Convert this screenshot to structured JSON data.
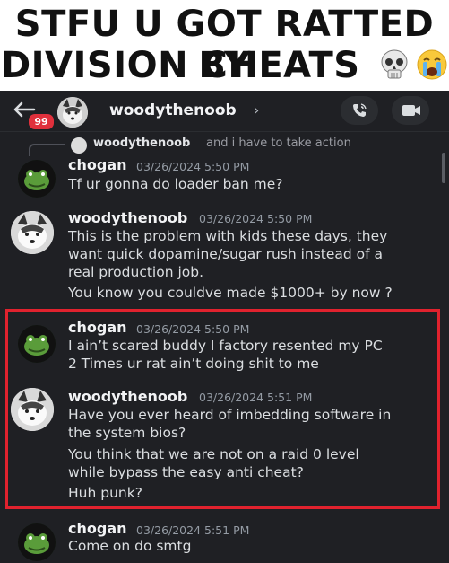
{
  "meme": {
    "line1": "STFU U GOT RATTED BY",
    "line2": "DIVISION CHEATS"
  },
  "header": {
    "badge_count": "99",
    "channel_name": "woodythenoob",
    "chevron": "›"
  },
  "reply": {
    "name": "woodythenoob",
    "text": "and i have to take action"
  },
  "messages": [
    {
      "author": "chogan",
      "timestamp": "03/26/2024 5:50 PM",
      "lines": [
        "Tf ur gonna do loader ban me?"
      ]
    },
    {
      "author": "woodythenoob",
      "timestamp": "03/26/2024 5:50 PM",
      "lines": [
        "This is the problem with kids these days, they",
        "want quick dopamine/sugar rush instead of a",
        "real production job.",
        "You know you couldve made $1000+ by now ?"
      ]
    },
    {
      "author": "chogan",
      "timestamp": "03/26/2024 5:50 PM",
      "lines": [
        "I ain’t scared buddy I factory resented my PC",
        "2 Times ur rat ain’t doing shit to me"
      ]
    },
    {
      "author": "woodythenoob",
      "timestamp": "03/26/2024 5:51 PM",
      "lines": [
        "Have you ever heard of imbedding software in",
        "the system bios?",
        "You think that we are not on a raid 0 level",
        "while bypass the easy anti cheat?",
        "Huh punk?"
      ]
    },
    {
      "author": "chogan",
      "timestamp": "03/26/2024 5:51 PM",
      "lines": [
        "Come on do smtg"
      ]
    }
  ],
  "colors": {
    "background": "#1f2024",
    "highlight": "#e0222e",
    "badge": "#e0303c"
  },
  "icons": [
    "back-arrow-icon",
    "phone-icon",
    "video-camera-icon",
    "skull-emoji",
    "crying-emoji"
  ]
}
